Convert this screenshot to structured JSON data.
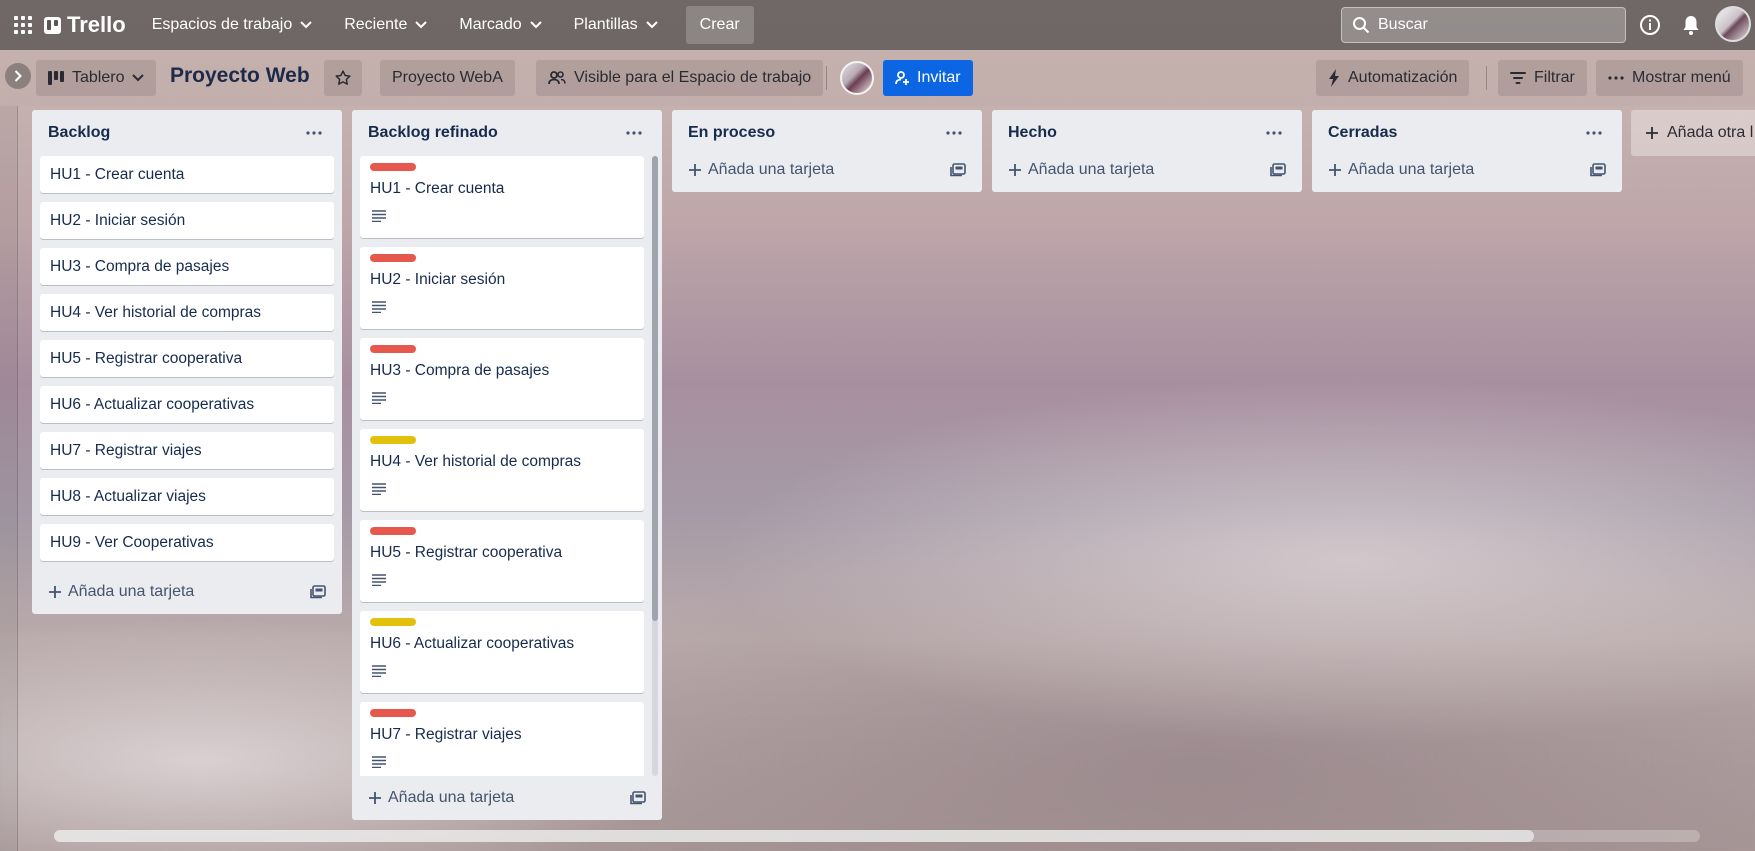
{
  "topbar": {
    "logo_text": "Trello",
    "nav": [
      {
        "label": "Espacios de trabajo"
      },
      {
        "label": "Reciente"
      },
      {
        "label": "Marcado"
      },
      {
        "label": "Plantillas"
      }
    ],
    "create_label": "Crear",
    "search_placeholder": "Buscar",
    "icons": [
      "apps-grid-icon",
      "search-icon",
      "info-icon",
      "bell-icon"
    ]
  },
  "board_header": {
    "view_label": "Tablero",
    "title": "Proyecto Web",
    "workspace_label": "Proyecto WebA",
    "visibility_label": "Visible para el Espacio de trabajo",
    "invite_label": "Invitar",
    "automation_label": "Automatización",
    "filter_label": "Filtrar",
    "menu_label": "Mostrar menú"
  },
  "colors": {
    "label_red": "#e5584b",
    "label_yellow": "#e2c10b",
    "invite_blue": "#0c66e4"
  },
  "lists": [
    {
      "title": "Backlog",
      "cards": [
        {
          "title": "HU1 - Crear cuenta"
        },
        {
          "title": "HU2 - Iniciar sesión"
        },
        {
          "title": "HU3 - Compra de pasajes"
        },
        {
          "title": "HU4 - Ver historial de compras"
        },
        {
          "title": "HU5 - Registrar cooperativa"
        },
        {
          "title": "HU6 - Actualizar cooperativas"
        },
        {
          "title": "HU7 - Registrar viajes"
        },
        {
          "title": "HU8 - Actualizar viajes"
        },
        {
          "title": "HU9 - Ver Cooperativas"
        }
      ],
      "add_label": "Añada una tarjeta"
    },
    {
      "title": "Backlog refinado",
      "cards": [
        {
          "title": "HU1 - Crear cuenta",
          "label": "red"
        },
        {
          "title": "HU2 - Iniciar sesión",
          "label": "red"
        },
        {
          "title": "HU3 - Compra de pasajes",
          "label": "red"
        },
        {
          "title": "HU4 - Ver historial de compras",
          "label": "yellow"
        },
        {
          "title": "HU5 - Registrar cooperativa",
          "label": "red"
        },
        {
          "title": "HU6 - Actualizar cooperativas",
          "label": "yellow"
        },
        {
          "title": "HU7 - Registrar viajes",
          "label": "red"
        }
      ],
      "add_label": "Añada una tarjeta"
    },
    {
      "title": "En proceso",
      "cards": [],
      "add_label": "Añada una tarjeta"
    },
    {
      "title": "Hecho",
      "cards": [],
      "add_label": "Añada una tarjeta"
    },
    {
      "title": "Cerradas",
      "cards": [],
      "add_label": "Añada una tarjeta"
    }
  ],
  "add_list_label": "Añada otra l"
}
